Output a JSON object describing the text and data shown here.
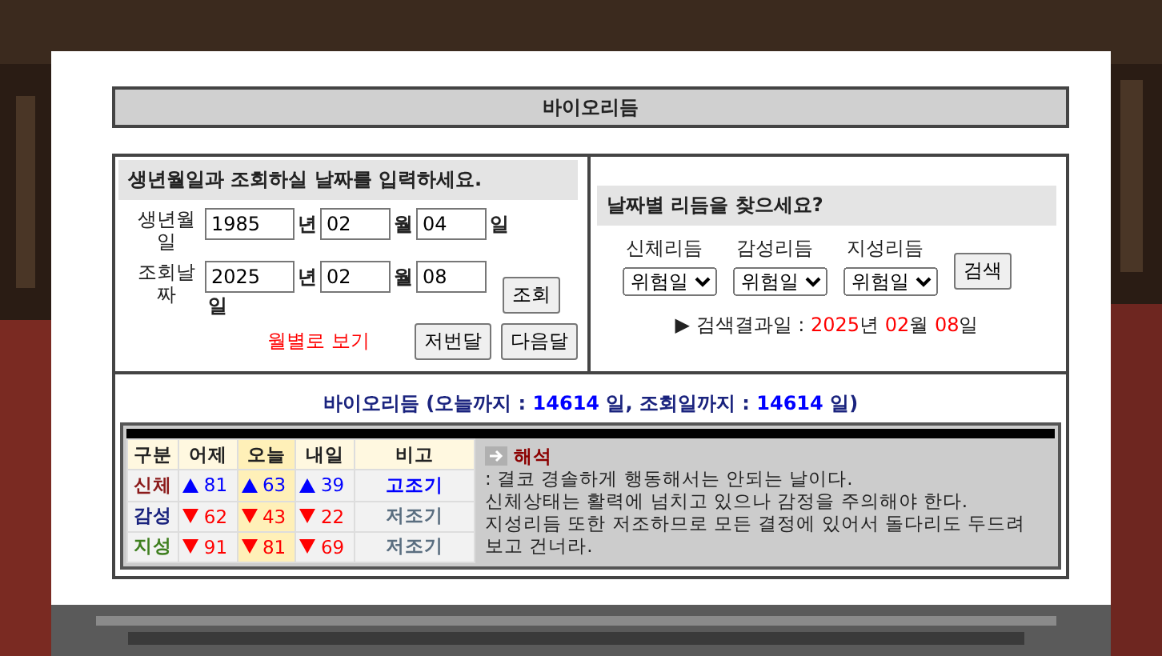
{
  "title": "바이오리듬",
  "form": {
    "heading": "생년월일과 조회하실 날짜를 입력하세요.",
    "rows": [
      {
        "label": "생년월일",
        "year": "1985",
        "year_unit": "년",
        "month": "02",
        "month_unit": "월",
        "day": "04",
        "day_unit": "일"
      },
      {
        "label": "조회날짜",
        "year": "2025",
        "year_unit": "년",
        "month": "02",
        "month_unit": "월",
        "day": "08",
        "day_unit": "일"
      }
    ],
    "query_button": "조회",
    "monthly_link": "월별로 보기",
    "buttons": [
      "저번달",
      "다음달"
    ]
  },
  "search": {
    "heading": "날짜별 리듬을 찾으세요?",
    "selects": [
      {
        "label": "신체리듬",
        "value": "위험일"
      },
      {
        "label": "감성리듬",
        "value": "위험일"
      },
      {
        "label": "지성리듬",
        "value": "위험일"
      }
    ],
    "button": "검색",
    "result_prefix": "▶ 검색결과일 : ",
    "year": "2025",
    "year_unit": "년",
    "month": "02",
    "month_unit": "월",
    "day": "08",
    "day_unit": "일"
  },
  "summary": [
    {
      "text": "바이오리듬",
      "emphasis": false
    },
    {
      "text": "(오늘까지 :",
      "emphasis": false
    },
    {
      "text": "14614",
      "emphasis": true
    },
    {
      "text": "일, 조회일까지 :",
      "emphasis": false
    },
    {
      "text": "14614",
      "emphasis": true
    },
    {
      "text": "일)",
      "emphasis": false
    }
  ],
  "table": {
    "columns": [
      "구분",
      "어제",
      "오늘",
      "내일",
      "비고"
    ],
    "rows": [
      {
        "name": "신체",
        "color": "#8b1a1a",
        "values": [
          {
            "rising": true,
            "value": "81"
          },
          {
            "rising": true,
            "value": "63"
          },
          {
            "rising": true,
            "value": "39"
          }
        ],
        "note": "고조기",
        "high": true
      },
      {
        "name": "감성",
        "color": "#1a237e",
        "values": [
          {
            "rising": false,
            "value": "62"
          },
          {
            "rising": false,
            "value": "43"
          },
          {
            "rising": false,
            "value": "22"
          }
        ],
        "note": "저조기",
        "high": false
      },
      {
        "name": "지성",
        "color": "#3f7f1f",
        "values": [
          {
            "rising": false,
            "value": "91"
          },
          {
            "rising": false,
            "value": "81"
          },
          {
            "rising": false,
            "value": "69"
          }
        ],
        "note": "저조기",
        "high": false
      }
    ]
  },
  "interpretation": {
    "heading": "해석",
    "lines": [
      ": 결코 경솔하게 행동해서는 안되는 날이다.",
      "신체상태는 활력에 넘치고 있으나 감정을 주의해야 한다.",
      "지성리듬 또한 저조하므로 모든 결정에 있어서 돌다리도 두드려 보고 건너라."
    ]
  }
}
